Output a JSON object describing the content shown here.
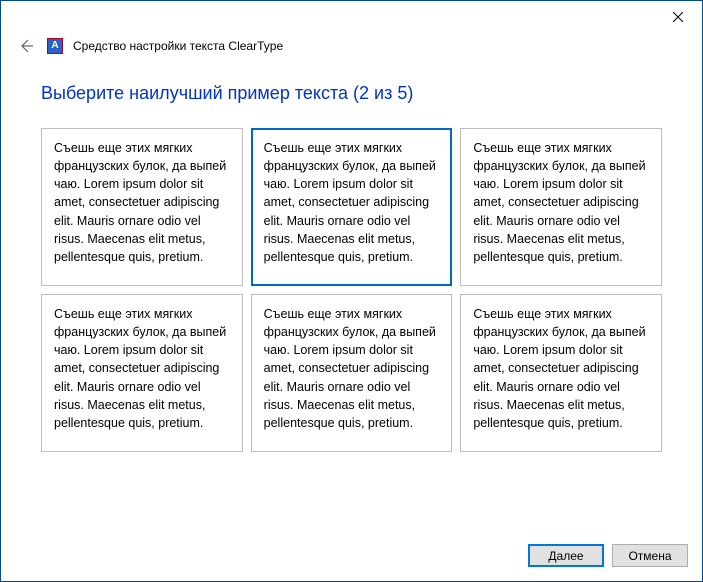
{
  "window": {
    "title": "Средство настройки текста ClearType",
    "app_icon_letter": "A"
  },
  "instruction": "Выберите наилучший пример текста (2 из 5)",
  "sample_text": "Съешь еще этих мягких французских булок, да выпей чаю. Lorem ipsum dolor sit amet, consectetuer adipiscing elit. Mauris ornare odio vel risus. Maecenas elit metus, pellentesque quis, pretium.",
  "samples": [
    {
      "selected": false
    },
    {
      "selected": true
    },
    {
      "selected": false
    },
    {
      "selected": false
    },
    {
      "selected": false
    },
    {
      "selected": false
    }
  ],
  "buttons": {
    "next": "Далее",
    "cancel": "Отмена"
  }
}
